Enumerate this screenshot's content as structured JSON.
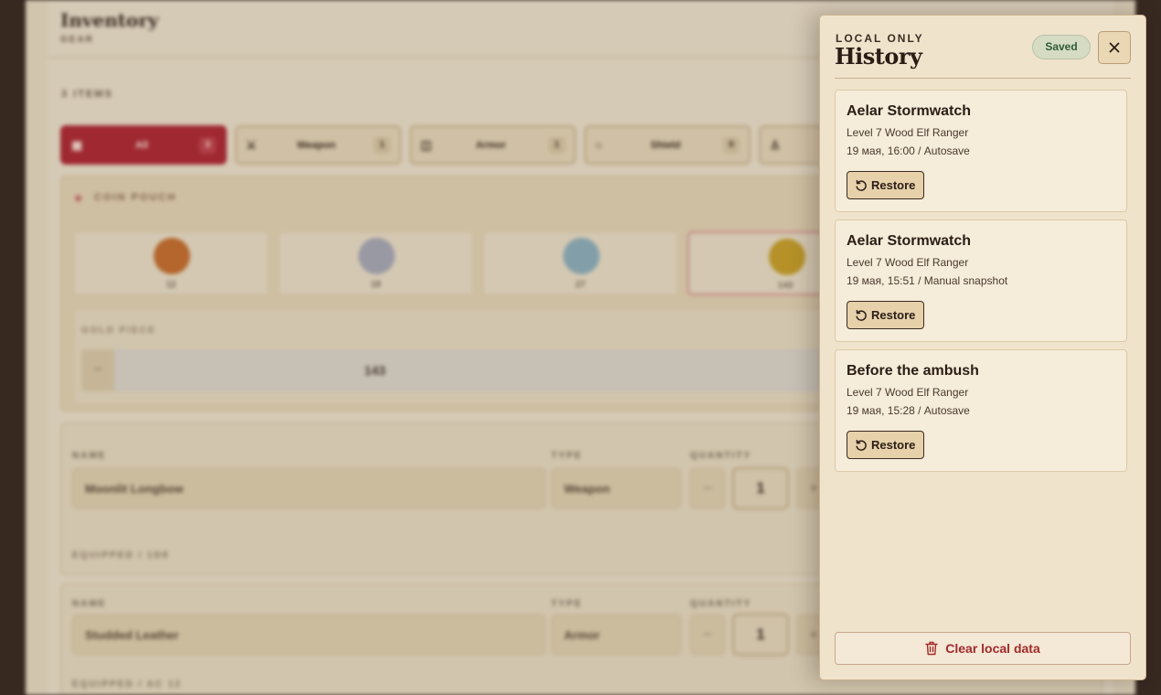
{
  "background": {
    "inventory_title": "Inventory",
    "inventory_subtitle": "GEAR",
    "item_count": "3 ITEMS",
    "filters": [
      {
        "label": "All",
        "count": "3",
        "icon": "bag-icon"
      },
      {
        "label": "Weapon",
        "count": "1",
        "icon": "swords-icon"
      },
      {
        "label": "Armor",
        "count": "1",
        "icon": "armor-icon"
      },
      {
        "label": "Shield",
        "count": "0",
        "icon": "shield-icon"
      },
      {
        "label": "",
        "count": "",
        "icon": "potion-icon"
      }
    ],
    "coin_pouch_title": "COIN POUCH",
    "coins": [
      {
        "value": "12",
        "color": "#c8702f"
      },
      {
        "value": "18",
        "color": "#a9aab8"
      },
      {
        "value": "27",
        "color": "#8fb1bd"
      },
      {
        "value": "143",
        "color": "#c9a12a"
      }
    ],
    "gold_label": "GOLD PIECE",
    "gold_value": "143",
    "items": [
      {
        "name_label": "NAME",
        "type_label": "TYPE",
        "quantity_label": "QUANTITY",
        "name": "Moonlit Longbow",
        "type": "Weapon",
        "quantity": "1",
        "footer": "EQUIPPED / 1D8"
      },
      {
        "name_label": "NAME",
        "type_label": "TYPE",
        "quantity_label": "QUANTITY",
        "name": "Studded Leather",
        "type": "Armor",
        "quantity": "1",
        "footer": "EQUIPPED / AC 12"
      }
    ]
  },
  "history": {
    "eyebrow": "LOCAL ONLY",
    "title": "History",
    "status_badge": "Saved",
    "snapshots": [
      {
        "name": "Aelar Stormwatch",
        "description": "Level 7 Wood Elf Ranger",
        "meta": "19 мая, 16:00 / Autosave",
        "restore_label": "Restore"
      },
      {
        "name": "Aelar Stormwatch",
        "description": "Level 7 Wood Elf Ranger",
        "meta": "19 мая, 15:51 / Manual snapshot",
        "restore_label": "Restore"
      },
      {
        "name": "Before the ambush",
        "description": "Level 7 Wood Elf Ranger",
        "meta": "19 мая, 15:28 / Autosave",
        "restore_label": "Restore"
      }
    ],
    "clear_label": "Clear local data"
  },
  "colors": {
    "accent_red": "#b02a35",
    "saved_green": "#2f5a3c",
    "danger": "#a52a2a"
  }
}
